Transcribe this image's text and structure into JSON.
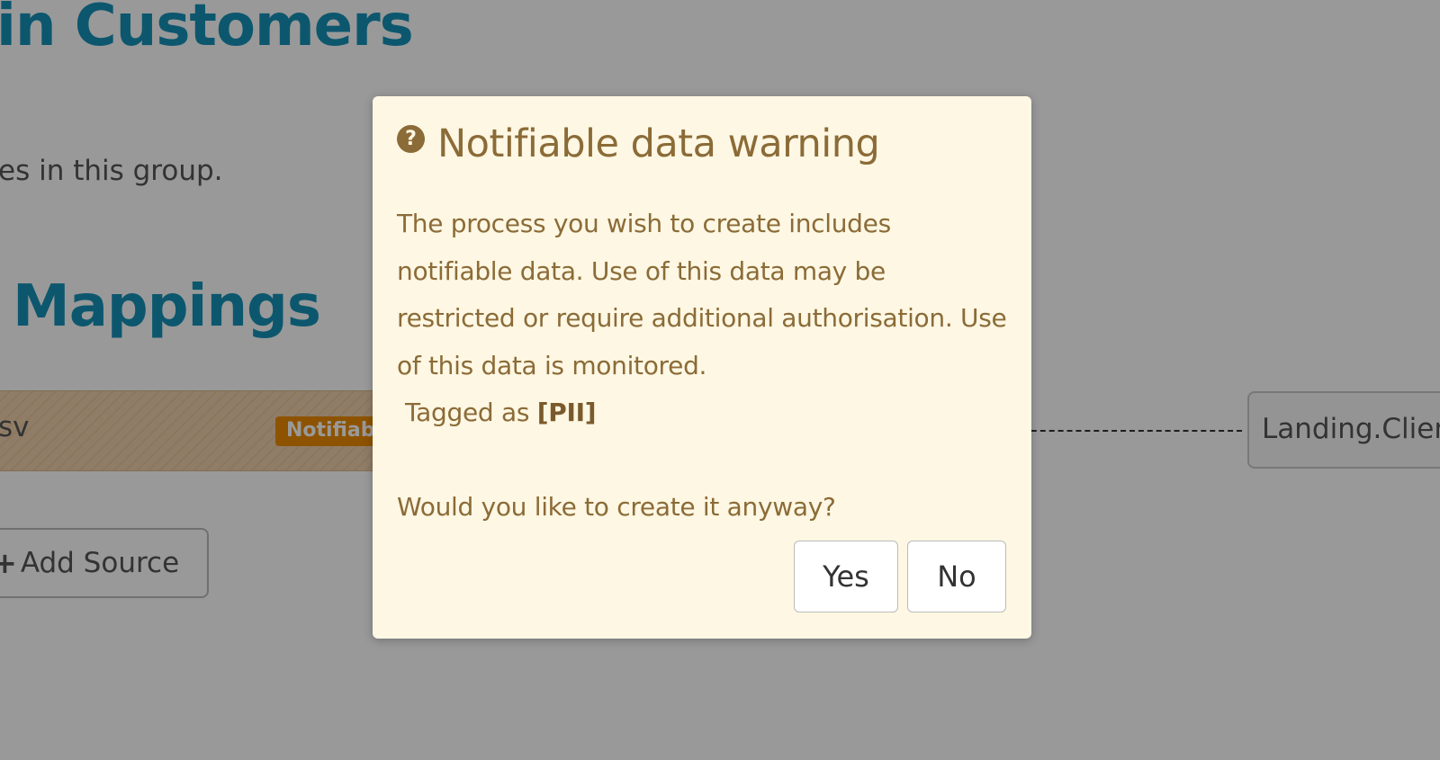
{
  "page": {
    "heading": "in Customers",
    "subtitle": "es in this group.",
    "mappings_heading": "Mappings",
    "source": {
      "name": "sv",
      "badge": "Notifiable"
    },
    "target": {
      "label": "Landing.Client"
    },
    "add_source_label": "Add Source"
  },
  "dialog": {
    "title": "Notifiable data warning",
    "icon": "question-icon",
    "message": "The process you wish to create includes notifiable data. Use of this data may be restricted or require additional authorisation. Use of this data is monitored.",
    "tag_prefix": "Tagged as",
    "tag_value": "[PII]",
    "question": "Would you like to create it anyway?",
    "yes_label": "Yes",
    "no_label": "No"
  },
  "colors": {
    "heading": "#1591b8",
    "dialog_background": "#fdf7e3",
    "dialog_text": "#8b6b37",
    "badge": "#ec8a00",
    "overlay": "rgba(0,0,0,0.4)"
  }
}
